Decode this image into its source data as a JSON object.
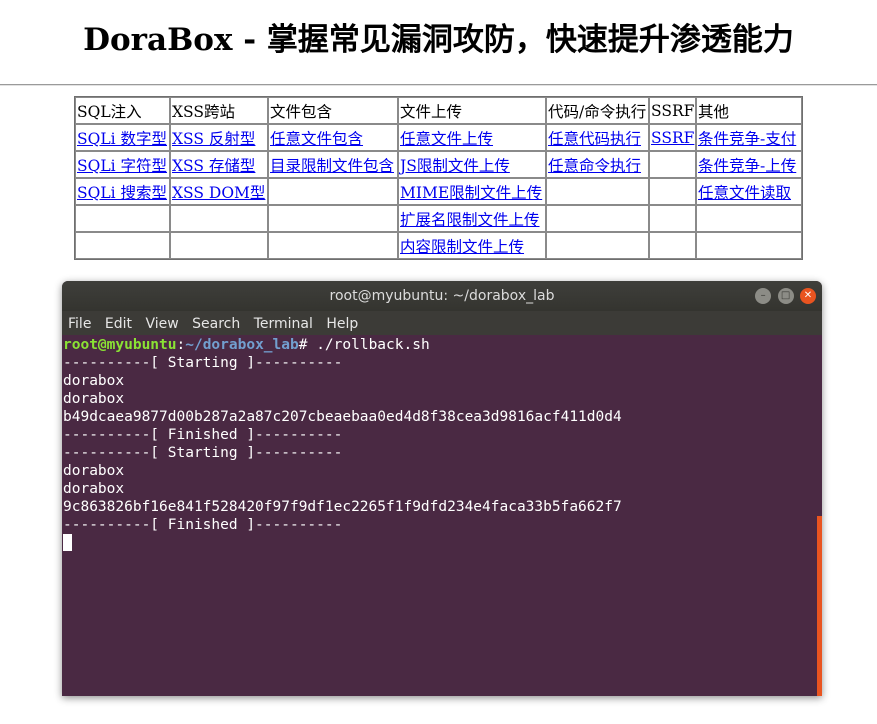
{
  "page": {
    "title": "DoraBox - 掌握常见漏洞攻防，快速提升渗透能力"
  },
  "nav_table": {
    "headers": [
      "SQL注入",
      "XSS跨站",
      "文件包含",
      "文件上传",
      "代码/命令执行",
      "SSRF",
      "其他"
    ],
    "rows": [
      [
        "SQLi 数字型",
        "XSS 反射型",
        "任意文件包含",
        "任意文件上传",
        "任意代码执行",
        "SSRF",
        "条件竞争-支付"
      ],
      [
        "SQLi 字符型",
        "XSS 存储型",
        "目录限制文件包含",
        "JS限制文件上传",
        "任意命令执行",
        "",
        "条件竞争-上传"
      ],
      [
        "SQLi 搜索型",
        "XSS DOM型",
        "",
        "MIME限制文件上传",
        "",
        "",
        "任意文件读取"
      ],
      [
        "",
        "",
        "",
        "扩展名限制文件上传",
        "",
        "",
        ""
      ],
      [
        "",
        "",
        "",
        "内容限制文件上传",
        "",
        "",
        ""
      ]
    ]
  },
  "terminal": {
    "title": "root@myubuntu: ~/dorabox_lab",
    "menu": [
      "File",
      "Edit",
      "View",
      "Search",
      "Terminal",
      "Help"
    ],
    "prompt_user": "root@myubuntu",
    "prompt_sep": ":",
    "prompt_path": "~/dorabox_lab",
    "prompt_suffix": "# ",
    "command": "./rollback.sh",
    "output": [
      "----------[ Starting ]----------",
      "dorabox",
      "dorabox",
      "b49dcaea9877d00b287a2a87c207cbeaebaa0ed4d8f38cea3d9816acf411d0d4",
      "----------[ Finished ]----------",
      "----------[ Starting ]----------",
      "dorabox",
      "dorabox",
      "9c863826bf16e841f528420f97f9df1ec2265f1f9dfd234e4faca33b5fa662f7",
      "----------[ Finished ]----------"
    ],
    "colors": {
      "background": "#4a2943",
      "prompt_user": "#8ae234",
      "prompt_path": "#729fcf",
      "close_button": "#e95420"
    }
  }
}
